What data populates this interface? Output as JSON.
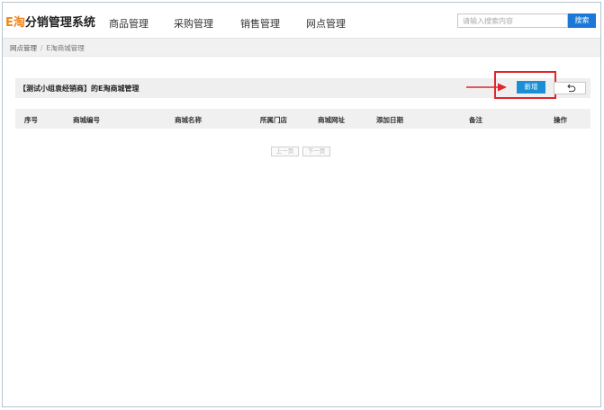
{
  "header": {
    "logo_e": "E",
    "logo_tao": "淘",
    "logo_rest": "分销管理系统",
    "nav": [
      {
        "label": "商品管理"
      },
      {
        "label": "采购管理"
      },
      {
        "label": "销售管理"
      },
      {
        "label": "网点管理"
      }
    ],
    "search": {
      "placeholder": "请输入搜索内容",
      "value": "",
      "button_label": "搜索"
    }
  },
  "breadcrumb": {
    "parent": "网点管理",
    "separator": "/",
    "current": "E淘商城管理"
  },
  "panel": {
    "title": "【测试小组袁经销商】的E淘商城管理",
    "add_label": "新增",
    "back_icon": "undo-arrow-icon"
  },
  "table": {
    "columns": [
      "序号",
      "商城编号",
      "商城名称",
      "所属门店",
      "商城网址",
      "添加日期",
      "备注",
      "操作"
    ],
    "rows": []
  },
  "pager": {
    "prev_label": "上一页",
    "next_label": "下一页"
  },
  "colors": {
    "accent": "#1b78d6",
    "brand": "#f08519",
    "annotation": "#e0252b"
  }
}
